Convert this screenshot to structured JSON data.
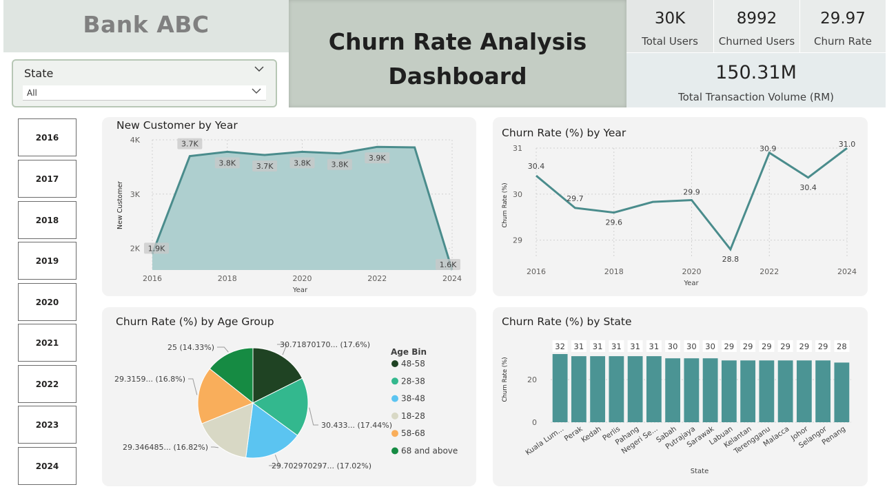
{
  "brand": {
    "title": "Bank ABC"
  },
  "slicer": {
    "title": "State",
    "value": "All"
  },
  "dashboard_title": {
    "line1": "Churn Rate Analysis",
    "line2": "Dashboard"
  },
  "kpis": {
    "total_users": {
      "value": "30K",
      "label": "Total Users"
    },
    "churned_users": {
      "value": "8992",
      "label": "Churned Users"
    },
    "churn_rate": {
      "value": "29.97",
      "label": "Churn Rate"
    },
    "total_volume": {
      "value": "150.31M",
      "label": "Total Transaction Volume (RM)"
    }
  },
  "year_buttons": [
    "2016",
    "2017",
    "2018",
    "2019",
    "2020",
    "2021",
    "2022",
    "2023",
    "2024"
  ],
  "icons": {
    "dropdown": "chevron-down-icon"
  },
  "colors": {
    "teal": "#4a8c8c",
    "area_fill": "#aecfcf",
    "bar": "#4b9494"
  },
  "chart_data": [
    {
      "id": "new_customer",
      "type": "area",
      "title": "New Customer by Year",
      "xlabel": "Year",
      "ylabel": "New Customer",
      "x": [
        2016,
        2017,
        2018,
        2019,
        2020,
        2021,
        2022,
        2023,
        2024
      ],
      "values": [
        1.9,
        3.7,
        3.78,
        3.72,
        3.78,
        3.75,
        3.87,
        3.86,
        1.6
      ],
      "data_labels": [
        "1.9K",
        "3.7K",
        "3.8K",
        "3.7K",
        "3.8K",
        "3.8K",
        "3.9K",
        "",
        "1.6K"
      ],
      "yticks": [
        "2K",
        "3K",
        "4K"
      ],
      "xticks": [
        "2016",
        "2018",
        "2020",
        "2022",
        "2024"
      ],
      "ylim": [
        1.6,
        4.0
      ]
    },
    {
      "id": "churn_year",
      "type": "line",
      "title": "Churn Rate (%) by Year",
      "xlabel": "Year",
      "ylabel": "Churn Rate (%)",
      "x": [
        2016,
        2017,
        2018,
        2019,
        2020,
        2021,
        2022,
        2023,
        2024
      ],
      "values": [
        30.4,
        29.7,
        29.6,
        29.83,
        29.87,
        28.8,
        30.9,
        30.36,
        31.0
      ],
      "data_labels": [
        "30.4",
        "29.7",
        "29.6",
        "",
        "29.9",
        "28.8",
        "30.9",
        "30.4",
        "31.0"
      ],
      "yticks": [
        "29",
        "30",
        "31"
      ],
      "xticks": [
        "2016",
        "2018",
        "2020",
        "2022",
        "2024"
      ],
      "ylim": [
        28.8,
        31.0
      ]
    },
    {
      "id": "churn_age",
      "type": "pie",
      "title": "Churn Rate (%) by Age Group",
      "legend_title": "Age Bin",
      "slices": [
        {
          "name": "48-58",
          "value": 30.7187,
          "label": "30.71870170... (17.6%)",
          "color": "#1f4323"
        },
        {
          "name": "28-38",
          "value": 30.433,
          "label": "30.433... (17.44%)",
          "color": "#33b88e"
        },
        {
          "name": "38-48",
          "value": 29.70297,
          "label": "29.702970297... (17.02%)",
          "color": "#5bc4f1"
        },
        {
          "name": "18-28",
          "value": 29.346485,
          "label": "29.346485... (16.82%)",
          "color": "#d8d8c5"
        },
        {
          "name": "58-68",
          "value": 29.3159,
          "label": "29.3159... (16.8%)",
          "color": "#f9ae5b"
        },
        {
          "name": "68 and above",
          "value": 25,
          "label": "25 (14.33%)",
          "color": "#168b43"
        }
      ]
    },
    {
      "id": "churn_state",
      "type": "bar",
      "title": "Churn Rate (%) by State",
      "xlabel": "State",
      "ylabel": "Churn Rate (%)",
      "categories": [
        "Kuala Lum...",
        "Perak",
        "Kedah",
        "Perlis",
        "Pahang",
        "Negeri Se...",
        "Sabah",
        "Putrajaya",
        "Sarawak",
        "Labuan",
        "Kelantan",
        "Terengganu",
        "Malacca",
        "Johor",
        "Selangor",
        "Penang"
      ],
      "values": [
        32,
        31,
        31,
        31,
        31,
        31,
        30,
        30,
        30,
        29,
        29,
        29,
        29,
        29,
        29,
        28
      ],
      "yticks": [
        "0",
        "20"
      ],
      "ylim": [
        0,
        32
      ]
    }
  ]
}
